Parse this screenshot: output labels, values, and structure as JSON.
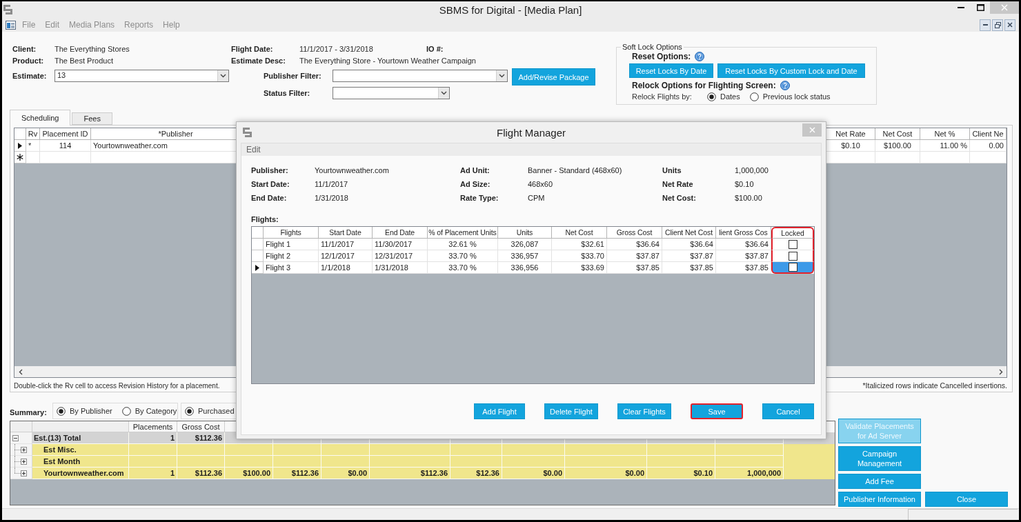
{
  "window": {
    "title": "SBMS for Digital - [Media Plan]"
  },
  "menu": [
    {
      "label": "File",
      "disabled": true
    },
    {
      "label": "Edit",
      "disabled": true
    },
    {
      "label": "Media Plans",
      "disabled": true
    },
    {
      "label": "Reports",
      "disabled": true
    },
    {
      "label": "Help",
      "disabled": true
    }
  ],
  "header": {
    "client": {
      "label": "Client:",
      "value": "The Everything Stores"
    },
    "product": {
      "label": "Product:",
      "value": "The Best Product"
    },
    "estimate": {
      "label": "Estimate:",
      "value": "13"
    },
    "flight_date": {
      "label": "Flight Date:",
      "value": "11/1/2017 - 3/31/2018"
    },
    "io_number": {
      "label": "IO #:"
    },
    "estimate_desc": {
      "label": "Estimate Desc:",
      "value": "The Everything Store - Yourtown Weather Campaign"
    },
    "publisher_filter": {
      "label": "Publisher Filter:"
    },
    "status_filter": {
      "label": "Status Filter:"
    },
    "add_revise_button": "Add/Revise Package"
  },
  "soft_lock": {
    "title": "Soft Lock Options",
    "reset_label": "Reset Options:",
    "reset_buttons": [
      "Reset Locks By Date",
      "Reset Locks By Custom Lock and Date"
    ],
    "relock_label": "Relock Options for Flighting Screen:",
    "relock_by_label": "Relock Flights by:",
    "relock_options": [
      {
        "label": "Dates",
        "selected": true
      },
      {
        "label": "Previous lock status",
        "selected": false
      }
    ]
  },
  "tabs": [
    {
      "label": "Scheduling",
      "selected": true
    },
    {
      "label": "Fees",
      "selected": false
    }
  ],
  "placements": {
    "columns": [
      "Rv",
      "Placement ID",
      "*Publisher",
      "Net Rate",
      "Net Cost",
      "Net %",
      "Client Ne"
    ],
    "rows": [
      {
        "kind": "data",
        "current": true,
        "cells": [
          "*",
          "114",
          "Yourtownweather.com",
          "$0.10",
          "$100.00",
          "11.00 %",
          "0.00"
        ]
      },
      {
        "kind": "new",
        "current": false
      }
    ]
  },
  "hint": "Double-click the Rv cell to access Revision History for a placement.",
  "footnote": "*Italicized rows indicate Cancelled insertions.",
  "summary": {
    "label": "Summary:",
    "group_by": [
      {
        "label": "By Publisher",
        "selected": true
      },
      {
        "label": "By Category",
        "selected": false
      }
    ],
    "amounts": [
      {
        "label": "Purchased",
        "selected": true
      }
    ],
    "columns": [
      "Placements",
      "Gross Cost"
    ],
    "rows": [
      {
        "kind": "total",
        "label": "Est.(13) Total",
        "expanded": true,
        "cells": [
          "1",
          "$112.36"
        ],
        "children": [
          {
            "kind": "item",
            "label": "Est Misc.",
            "expanded": false
          },
          {
            "kind": "item",
            "label": "Est Month",
            "expanded": false
          },
          {
            "kind": "item",
            "label": "Yourtownweather.com",
            "expanded": false,
            "cells": [
              "1",
              "$112.36",
              "$100.00",
              "$112.36",
              "$0.00",
              "$112.36",
              "$12.36",
              "$0.00",
              "$0.00",
              "$0.10",
              "1,000,000"
            ]
          }
        ]
      }
    ]
  },
  "side_buttons": [
    [
      {
        "label": "Validate Placements for Ad Server",
        "disabled": true
      },
      {
        "label": "Campaign Management",
        "disabled": false
      },
      {
        "label": "Add Fee",
        "disabled": false
      },
      {
        "label": "Publisher Information",
        "disabled": false
      }
    ],
    [
      {
        "label": "Close",
        "disabled": false
      }
    ]
  ],
  "flight_manager": {
    "title": "Flight Manager",
    "menu": [
      "Edit"
    ],
    "details": [
      [
        {
          "label": "Publisher:",
          "value": "Yourtownweather.com"
        },
        {
          "label": "Start Date:",
          "value": "11/1/2017"
        },
        {
          "label": "End Date:",
          "value": "1/31/2018"
        }
      ],
      [
        {
          "label": "Ad Unit:",
          "value": "Banner - Standard (468x60)"
        },
        {
          "label": "Ad Size:",
          "value": "468x60"
        },
        {
          "label": "Rate Type:",
          "value": "CPM"
        }
      ],
      [
        {
          "label": "Units",
          "value": "1,000,000"
        },
        {
          "label": "Net Rate",
          "value": "$0.10"
        },
        {
          "label": "Net Cost:",
          "value": "$100.00"
        }
      ]
    ],
    "flights_label": "Flights:",
    "columns": [
      {
        "label": "Flights",
        "highlighted": false
      },
      {
        "label": "Start Date",
        "highlighted": false
      },
      {
        "label": "End Date",
        "highlighted": false
      },
      {
        "label": "% of Placement Units",
        "highlighted": false
      },
      {
        "label": "Units",
        "highlighted": false
      },
      {
        "label": "Net Cost",
        "highlighted": false
      },
      {
        "label": "Gross Cost",
        "highlighted": false
      },
      {
        "label": "Client Net Cost",
        "highlighted": false
      },
      {
        "label": "lient Gross Cos",
        "highlighted": false
      },
      {
        "label": "Locked",
        "highlighted": true
      }
    ],
    "rows": [
      {
        "cells": [
          "Flight 1",
          "11/1/2017",
          "11/30/2017",
          "32.61 %",
          "326,087",
          "$32.61",
          "$36.64",
          "$36.64",
          "$36.64"
        ],
        "locked": false,
        "selected": false
      },
      {
        "cells": [
          "Flight 2",
          "12/1/2017",
          "12/31/2017",
          "33.70 %",
          "336,957",
          "$33.70",
          "$37.87",
          "$37.87",
          "$37.87"
        ],
        "locked": false,
        "selected": false
      },
      {
        "cells": [
          "Flight 3",
          "1/1/2018",
          "1/31/2018",
          "33.70 %",
          "336,956",
          "$33.69",
          "$37.85",
          "$37.85",
          "$37.85"
        ],
        "locked": false,
        "selected": true
      }
    ],
    "buttons": [
      {
        "label": "Add Flight",
        "highlighted": false
      },
      {
        "label": "Delete Flight",
        "highlighted": false
      },
      {
        "label": "Clear Flights",
        "highlighted": false
      },
      {
        "label": "Save",
        "highlighted": true
      },
      {
        "label": "Cancel",
        "highlighted": false
      }
    ]
  }
}
